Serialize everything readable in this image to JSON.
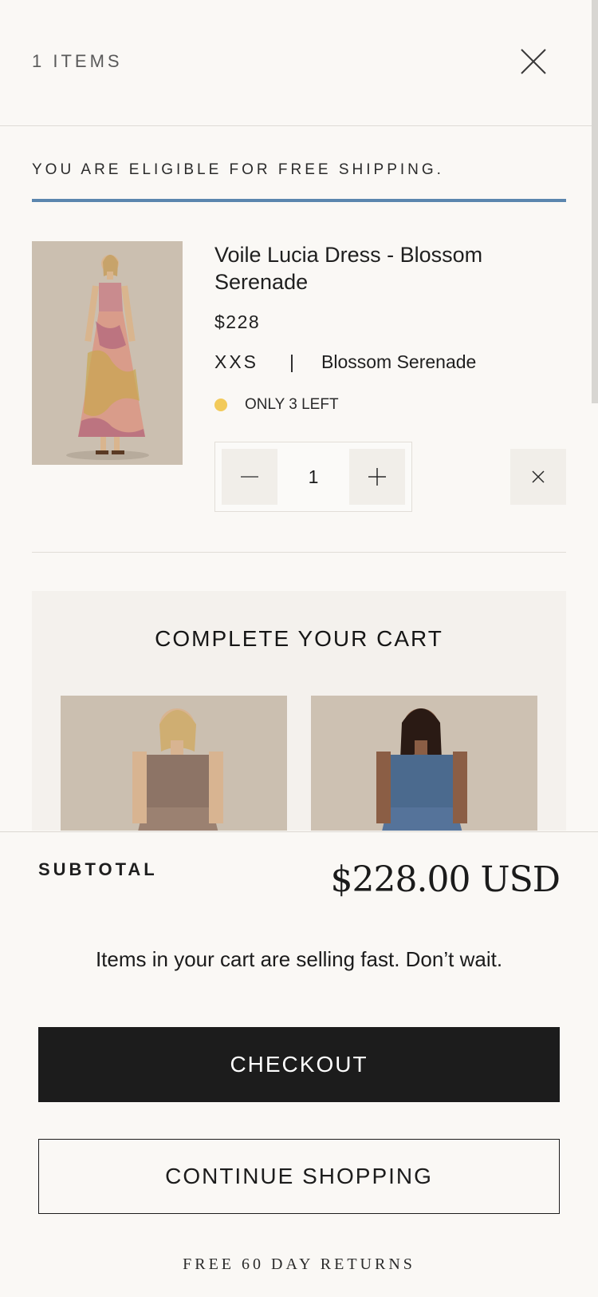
{
  "header": {
    "items_count": "1 ITEMS",
    "close_icon": "close-icon"
  },
  "shipping": {
    "message": "YOU ARE ELIGIBLE FOR FREE SHIPPING.",
    "progress_percent": 100,
    "bar_color": "#5b86ae"
  },
  "cart_item": {
    "title": "Voile Lucia Dress - Blossom Serenade",
    "price": "$228",
    "size": "XXS",
    "separator": "|",
    "color_name": "Blossom Serenade",
    "stock": "ONLY 3 LEFT",
    "stock_dot_color": "#f2ca5a",
    "quantity": "1",
    "image_icon": "dress-photo"
  },
  "upsell": {
    "title": "COMPLETE YOUR CART",
    "cards": [
      {
        "image": "brown-floral-smocked-dress-photo"
      },
      {
        "image": "blue-floral-smocked-dress-photo"
      }
    ]
  },
  "footer": {
    "subtotal_label": "SUBTOTAL",
    "subtotal_value": "$228.00 USD",
    "urgency": "Items in your cart are selling fast. Don’t wait.",
    "checkout_label": "CHECKOUT",
    "continue_label": "CONTINUE SHOPPING",
    "returns": "FREE 60 DAY RETURNS"
  },
  "colors": {
    "background": "#faf8f5",
    "checkout_button": "#1c1c1c"
  }
}
